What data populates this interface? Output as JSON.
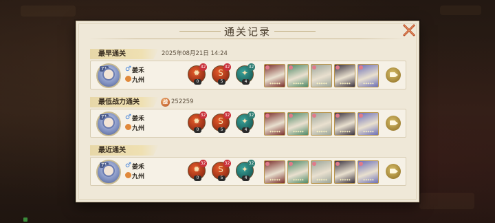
{
  "modal": {
    "title": "通关记录",
    "close_icon": "close-x-icon"
  },
  "player": {
    "name": "姜禾",
    "server": "九州",
    "gender_icon": "♂",
    "level": "71"
  },
  "sections": [
    {
      "key": "earliest",
      "label": "最早通关",
      "extra_text": "2025年08月21日  14:24",
      "skills": [
        {
          "glyph": "✹",
          "level": "32",
          "count": "0",
          "color": "red"
        },
        {
          "glyph": "S",
          "level": "32",
          "count": "5",
          "color": "red"
        },
        {
          "glyph": "✦",
          "level": "32",
          "count": "4",
          "color": "teal"
        }
      ]
    },
    {
      "key": "lowest-power",
      "label": "最低战力通关",
      "power_icon_text": "战",
      "extra_text": "252259",
      "skills": [
        {
          "glyph": "✹",
          "level": "32",
          "count": "0",
          "color": "red"
        },
        {
          "glyph": "S",
          "level": "32",
          "count": "5",
          "color": "red"
        },
        {
          "glyph": "✦",
          "level": "32",
          "count": "4",
          "color": "teal"
        }
      ]
    },
    {
      "key": "recent",
      "label": "最近通关",
      "extra_text": "",
      "skills": [
        {
          "glyph": "✹",
          "level": "32",
          "count": "0",
          "color": "red"
        },
        {
          "glyph": "S",
          "level": "32",
          "count": "5",
          "color": "red"
        },
        {
          "glyph": "✦",
          "level": "32",
          "count": "4",
          "color": "teal"
        }
      ]
    }
  ],
  "team_cards": [
    {
      "icon": "hero-card-red-icon",
      "bg": "#7a2f2c",
      "stars": "✦✦✦✦✦"
    },
    {
      "icon": "hero-card-green-icon",
      "bg": "#4f8a68",
      "stars": "✦✦✦✦✦"
    },
    {
      "icon": "hero-card-white-icon",
      "bg": "#9aa59a",
      "stars": "✦✦✦✦✦"
    },
    {
      "icon": "hero-card-dark-icon",
      "bg": "#3a3340",
      "stars": "✦✦✦✦✦"
    },
    {
      "icon": "hero-card-blue-icon",
      "bg": "#6b6fb8",
      "stars": "✦✦✦✦✦"
    }
  ],
  "colors": {
    "panel": "#efe8d8",
    "label_bar": "#e7d7a8",
    "accent_red": "#c9303a",
    "accent_teal": "#2d7d74"
  }
}
